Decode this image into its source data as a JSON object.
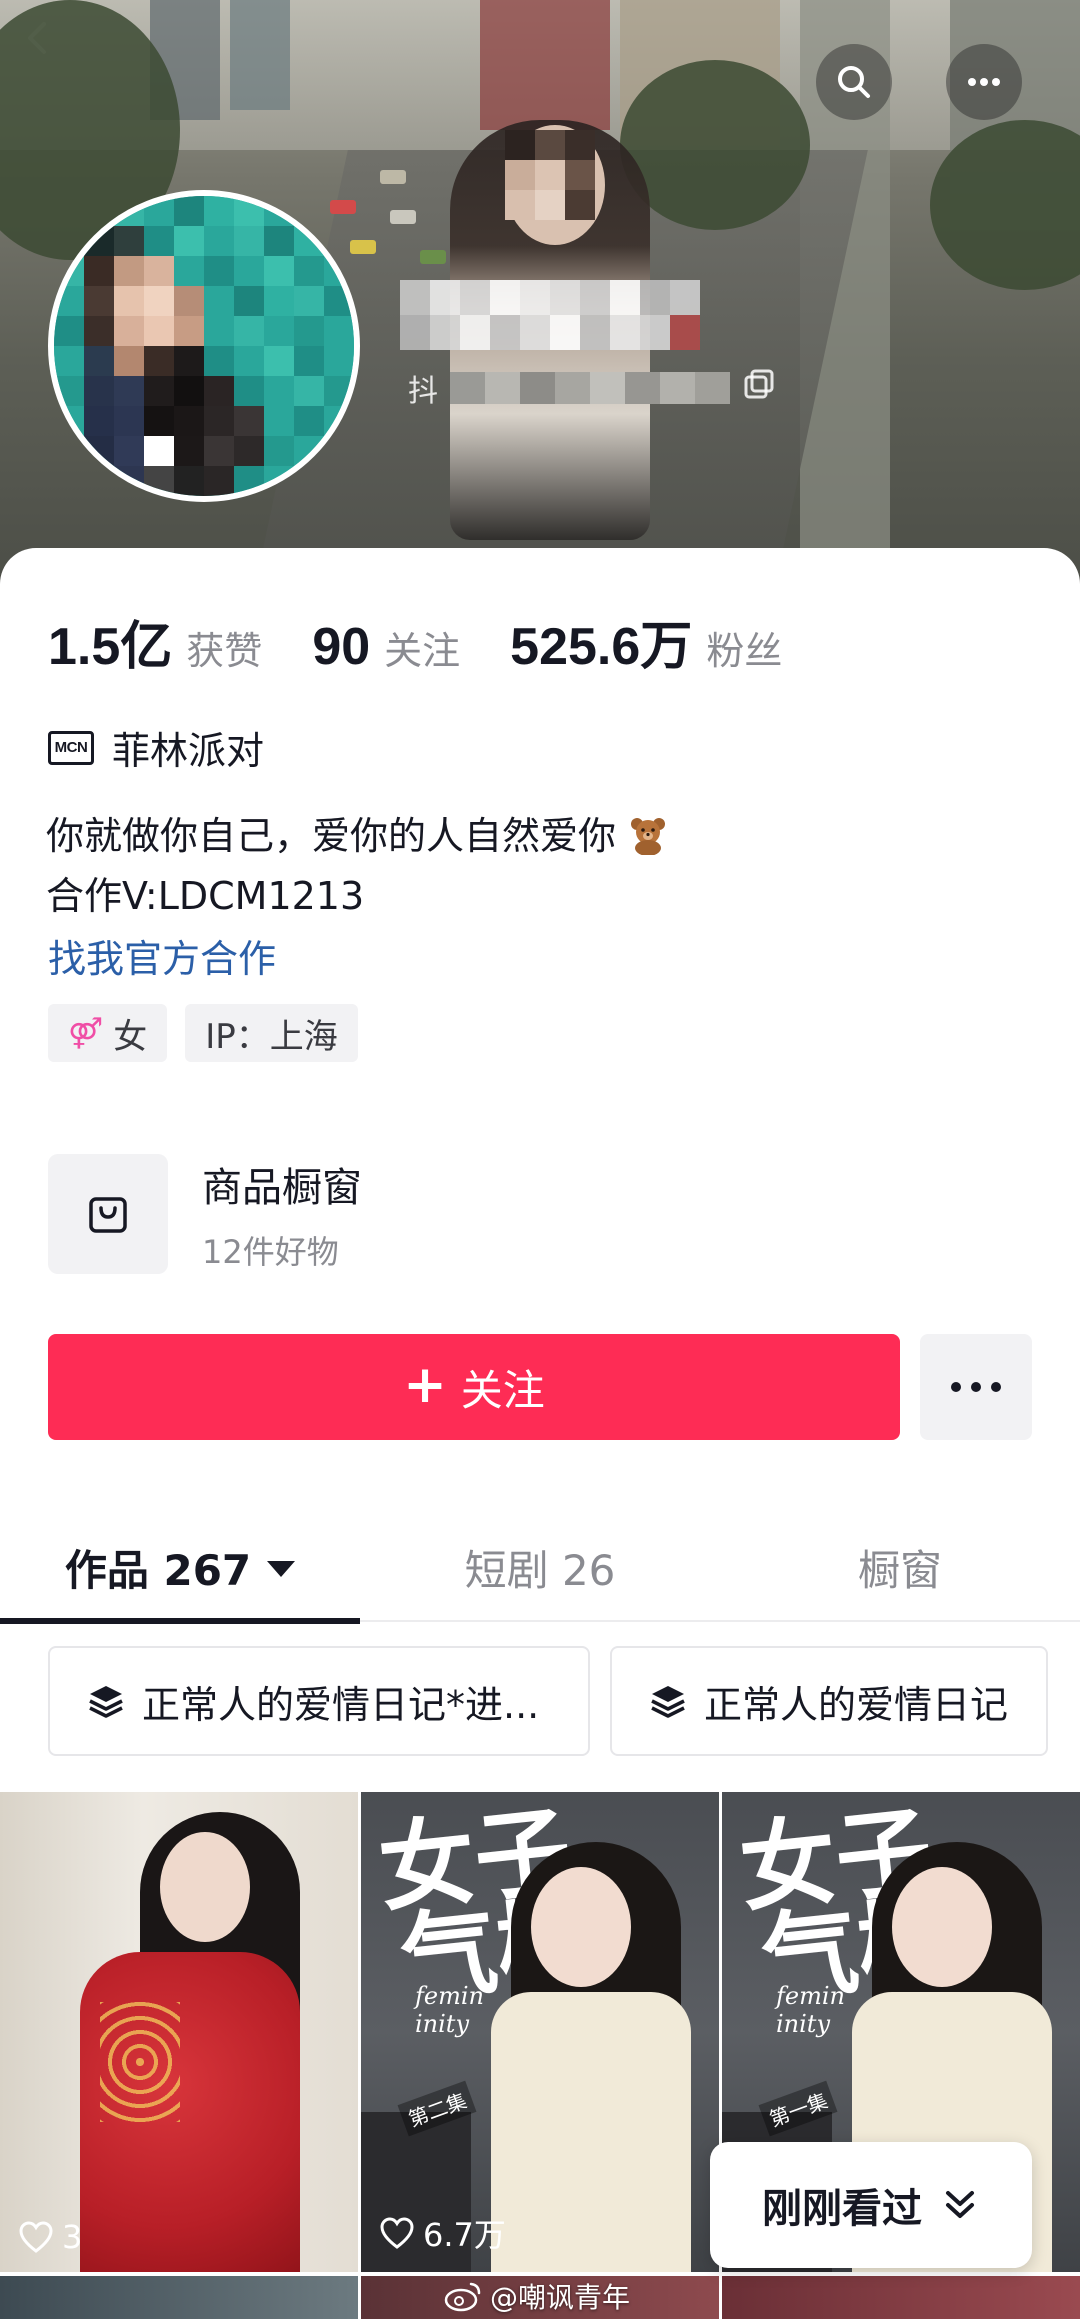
{
  "header": {
    "id_prefix": "抖"
  },
  "stats": [
    {
      "value": "1.5亿",
      "label": "获赞"
    },
    {
      "value": "90",
      "label": "关注"
    },
    {
      "value": "525.6万",
      "label": "粉丝"
    }
  ],
  "mcn": {
    "badge": "MCN",
    "name": "菲林派对"
  },
  "bio": {
    "line1": "你就做你自己，爱你的人自然爱你",
    "line2": "合作V:LDCM1213",
    "link": "找我官方合作"
  },
  "tags": {
    "gender_symbol": "⚤",
    "gender": "女",
    "ip": "IP：上海"
  },
  "shop": {
    "title": "商品橱窗",
    "subtitle": "12件好物"
  },
  "actions": {
    "follow_plus": "+",
    "follow_label": "关注"
  },
  "tabs": [
    {
      "label": "作品 267"
    },
    {
      "label": "短剧 26"
    },
    {
      "label": "橱窗"
    }
  ],
  "collections": [
    {
      "label": "正常人的爱情日记*进..."
    },
    {
      "label": "正常人的爱情日记"
    }
  ],
  "videos": [
    {
      "likes": "3"
    },
    {
      "likes": "6.7万"
    }
  ],
  "poster": {
    "title_char1": "女子",
    "title_char2": "气概",
    "subtitle_en": "femin\ninity",
    "episode_2": "第二集",
    "episode_1": "第一集"
  },
  "recent": {
    "label": "刚刚看过"
  },
  "watermark": {
    "text": "@嘲讽青年"
  },
  "colors": {
    "accent": "#fe2c55",
    "link": "#2b5fa8",
    "muted": "#8a8b91",
    "gender": "#f04ea6"
  },
  "icons": {
    "back": "chevron-left-icon",
    "search": "search-icon",
    "more": "more-horizontal-icon",
    "copy": "copy-icon",
    "shop": "shopping-bag-icon",
    "collection": "layers-icon",
    "like": "heart-outline-icon",
    "expand": "double-chevron-down-icon",
    "weibo": "weibo-icon"
  }
}
